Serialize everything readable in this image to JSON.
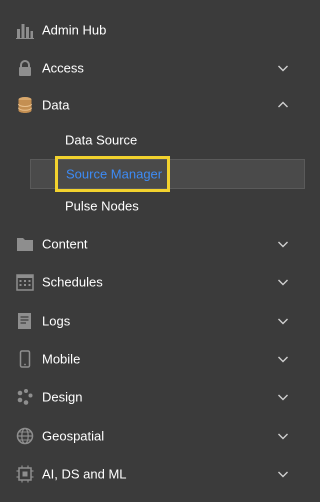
{
  "nav": {
    "items": [
      {
        "label": "Admin Hub",
        "icon": "bar-chart-icon",
        "has_chevron": false
      },
      {
        "label": "Access",
        "icon": "lock-icon",
        "has_chevron": true,
        "chevron": "down"
      },
      {
        "label": "Data",
        "icon": "database-icon",
        "has_chevron": true,
        "chevron": "up",
        "expanded": true,
        "children": [
          {
            "label": "Data Source"
          },
          {
            "label": "Source Manager",
            "selected": true
          },
          {
            "label": "Pulse Nodes"
          }
        ]
      },
      {
        "label": "Content",
        "icon": "folder-icon",
        "has_chevron": true,
        "chevron": "down"
      },
      {
        "label": "Schedules",
        "icon": "calendar-icon",
        "has_chevron": true,
        "chevron": "down"
      },
      {
        "label": "Logs",
        "icon": "document-icon",
        "has_chevron": true,
        "chevron": "down"
      },
      {
        "label": "Mobile",
        "icon": "mobile-icon",
        "has_chevron": true,
        "chevron": "down"
      },
      {
        "label": "Design",
        "icon": "palette-icon",
        "has_chevron": true,
        "chevron": "down"
      },
      {
        "label": "Geospatial",
        "icon": "globe-icon",
        "has_chevron": true,
        "chevron": "down"
      },
      {
        "label": "AI, DS and ML",
        "icon": "ai-chip-icon",
        "has_chevron": true,
        "chevron": "down"
      }
    ]
  },
  "colors": {
    "background": "#3b3b3b",
    "text": "#ffffff",
    "icon": "#8e8e8e",
    "database_icon": "#d9a86c",
    "selected_text": "#3d8bf5",
    "highlight_border": "#f2d22e"
  }
}
